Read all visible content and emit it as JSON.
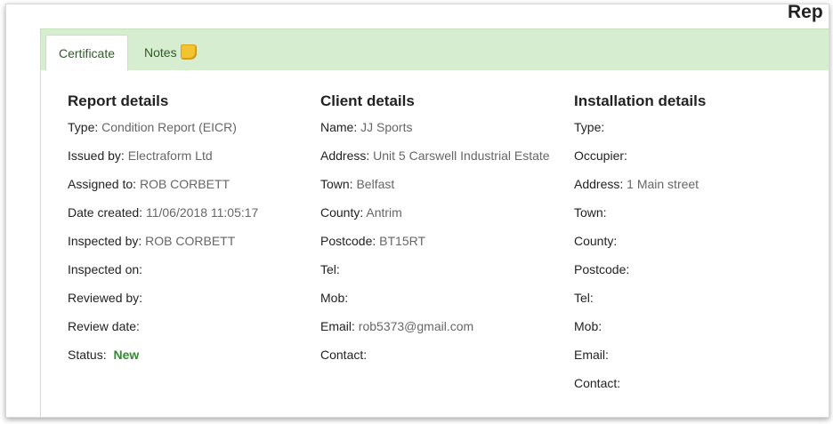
{
  "page": {
    "heading": "Rep"
  },
  "tabs": [
    {
      "label": "Certificate",
      "active": true
    },
    {
      "label": "Notes",
      "icon": "sticky-note-icon"
    }
  ],
  "report_details": {
    "title": "Report details",
    "rows": [
      {
        "label": "Type:",
        "value": "Condition Report (EICR)"
      },
      {
        "label": "Issued by:",
        "value": "Electraform Ltd"
      },
      {
        "label": "Assigned to:",
        "value": "ROB CORBETT"
      },
      {
        "label": "Date created:",
        "value": "11/06/2018 11:05:17"
      },
      {
        "label": "Inspected by:",
        "value": "ROB CORBETT"
      },
      {
        "label": "Inspected on:",
        "value": ""
      },
      {
        "label": "Reviewed by:",
        "value": ""
      },
      {
        "label": "Review date:",
        "value": ""
      },
      {
        "label": "Status:",
        "value": "New"
      }
    ]
  },
  "client_details": {
    "title": "Client details",
    "rows": [
      {
        "label": "Name:",
        "value": "JJ Sports"
      },
      {
        "label": "Address:",
        "value": "Unit 5 Carswell Industrial Estate"
      },
      {
        "label": "Town:",
        "value": "Belfast"
      },
      {
        "label": "County:",
        "value": "Antrim"
      },
      {
        "label": "Postcode:",
        "value": "BT15RT"
      },
      {
        "label": "Tel:",
        "value": ""
      },
      {
        "label": "Mob:",
        "value": ""
      },
      {
        "label": "Email:",
        "value": "rob5373@gmail.com"
      },
      {
        "label": "Contact:",
        "value": ""
      }
    ]
  },
  "installation_details": {
    "title": "Installation details",
    "rows": [
      {
        "label": "Type:",
        "value": ""
      },
      {
        "label": "Occupier:",
        "value": ""
      },
      {
        "label": "Address:",
        "value": "1 Main street"
      },
      {
        "label": "Town:",
        "value": ""
      },
      {
        "label": "County:",
        "value": ""
      },
      {
        "label": "Postcode:",
        "value": ""
      },
      {
        "label": "Tel:",
        "value": ""
      },
      {
        "label": "Mob:",
        "value": ""
      },
      {
        "label": "Email:",
        "value": ""
      },
      {
        "label": "Contact:",
        "value": ""
      }
    ]
  },
  "colors": {
    "tab_bar": "#d7edcf",
    "status_new": "#2e8b2e"
  }
}
